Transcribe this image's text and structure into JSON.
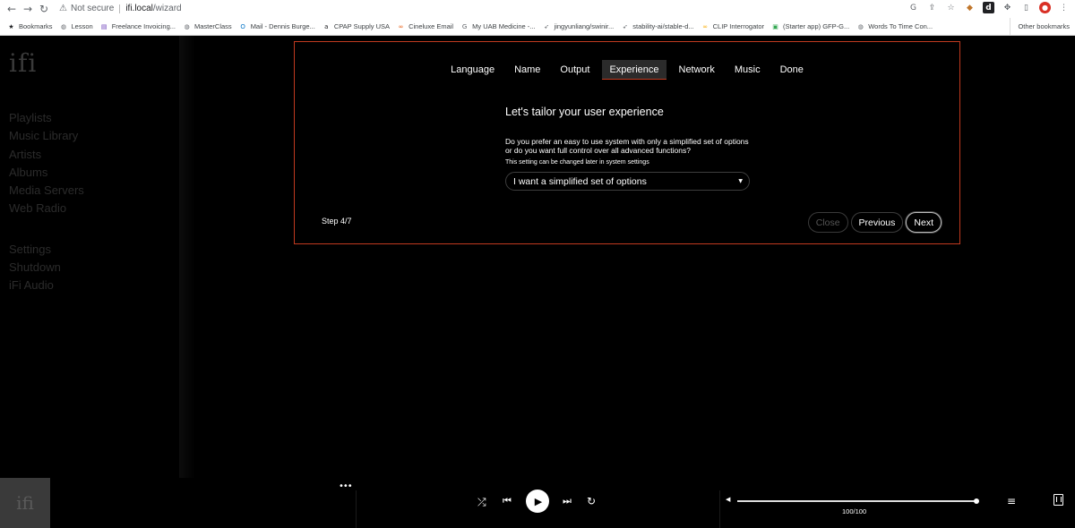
{
  "browser": {
    "security_label": "Not secure",
    "host": "ifi.local",
    "path": "/wizard",
    "bookmarks": [
      {
        "label": "Bookmarks",
        "icon": "star-icon",
        "color": "#202124"
      },
      {
        "label": "Lesson",
        "icon": "globe-icon",
        "color": "#5f6368"
      },
      {
        "label": "Freelance Invoicing...",
        "icon": "invoice-icon",
        "color": "#673ab7"
      },
      {
        "label": "MasterClass",
        "icon": "globe-icon",
        "color": "#5f6368"
      },
      {
        "label": "Mail - Dennis Burge...",
        "icon": "outlook-icon",
        "color": "#0072c6"
      },
      {
        "label": "CPAP Supply USA",
        "icon": "amazon-icon",
        "color": "#202124"
      },
      {
        "label": "Cineluxe Email",
        "icon": "cineluxe-icon",
        "color": "#e8590c"
      },
      {
        "label": "My UAB Medicine -...",
        "icon": "google-icon",
        "color": "#5f6368"
      },
      {
        "label": "jingyunliang/swinir...",
        "icon": "rocket-icon",
        "color": "#5f6368"
      },
      {
        "label": "stability-ai/stable-d...",
        "icon": "rocket-icon",
        "color": "#5f6368"
      },
      {
        "label": "CLIP Interrogator",
        "icon": "colab-icon",
        "color": "#f9ab00"
      },
      {
        "label": "(Starter app) GFP-G...",
        "icon": "replit-icon",
        "color": "#34a853"
      },
      {
        "label": "Words To Time Con...",
        "icon": "globe-icon",
        "color": "#5f6368"
      }
    ],
    "other_bookmarks": "Other bookmarks"
  },
  "sidebar": {
    "logo": "ifi",
    "items": [
      "Playlists",
      "Music Library",
      "Artists",
      "Albums",
      "Media Servers",
      "Web Radio"
    ],
    "items2": [
      "Settings",
      "Shutdown",
      "iFi Audio"
    ]
  },
  "wizard": {
    "tabs": [
      "Language",
      "Name",
      "Output",
      "Experience",
      "Network",
      "Music",
      "Done"
    ],
    "active_tab": "Experience",
    "headline": "Let's tailor your user experience",
    "question": "Do you prefer an easy to use system with only a simplified set of options or do you want full control over all advanced functions?",
    "hint": "This setting can be changed later in system settings",
    "select_value": "I want a simplified set of options",
    "step": "Step 4/7",
    "buttons": {
      "close": "Close",
      "previous": "Previous",
      "next": "Next"
    }
  },
  "player": {
    "album_logo": "ifi",
    "more": "•••",
    "volume": 100,
    "volume_label": "100/100"
  },
  "colors": {
    "accent": "#c13a1f",
    "background": "#000000"
  }
}
